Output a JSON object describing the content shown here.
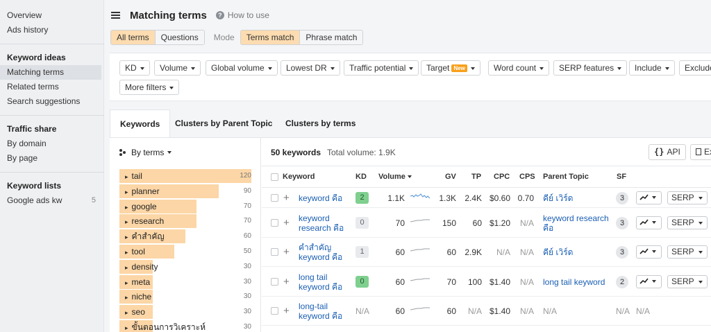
{
  "sidebar": {
    "top_items": [
      {
        "label": "Overview"
      },
      {
        "label": "Ads history"
      }
    ],
    "keyword_ideas": {
      "heading": "Keyword ideas",
      "items": [
        {
          "label": "Matching terms",
          "active": true
        },
        {
          "label": "Related terms"
        },
        {
          "label": "Search suggestions"
        }
      ]
    },
    "traffic_share": {
      "heading": "Traffic share",
      "items": [
        {
          "label": "By domain"
        },
        {
          "label": "By page"
        }
      ]
    },
    "keyword_lists": {
      "heading": "Keyword lists",
      "items": [
        {
          "label": "Google ads kw",
          "count": "5"
        }
      ]
    }
  },
  "header": {
    "title": "Matching terms",
    "how_to": "How to use",
    "help_glyph": "?"
  },
  "mode_bar": {
    "term_types": [
      "All terms",
      "Questions"
    ],
    "mode_label": "Mode",
    "match_modes": [
      "Terms match",
      "Phrase match"
    ]
  },
  "filters": {
    "buttons": [
      "KD",
      "Volume",
      "Global volume",
      "Lowest DR",
      "Traffic potential",
      "Target",
      "Word count",
      "SERP features",
      "Include",
      "Exclude"
    ],
    "new_badge": "New",
    "more": "More filters"
  },
  "tabs": [
    "Keywords",
    "Clusters by Parent Topic",
    "Clusters by terms"
  ],
  "terms_panel": {
    "sort_label": "By terms",
    "items": [
      {
        "label": "tail",
        "count": "120",
        "value": 120
      },
      {
        "label": "planner",
        "count": "90",
        "value": 90
      },
      {
        "label": "google",
        "count": "70",
        "value": 70
      },
      {
        "label": "research",
        "count": "70",
        "value": 70
      },
      {
        "label": "คำสำคัญ",
        "count": "60",
        "value": 60
      },
      {
        "label": "tool",
        "count": "50",
        "value": 50
      },
      {
        "label": "density",
        "count": "30",
        "value": 30
      },
      {
        "label": "meta",
        "count": "30",
        "value": 30
      },
      {
        "label": "niche",
        "count": "30",
        "value": 30
      },
      {
        "label": "seo",
        "count": "30",
        "value": 30
      },
      {
        "label": "ขั้นตอนการวิเคราะห์",
        "count": "30",
        "value": 30
      }
    ]
  },
  "table": {
    "count_label": "50 keywords",
    "total_volume": "Total volume: 1.9K",
    "api_label": "API",
    "api_glyph": "{}",
    "export_label": "Export",
    "columns": [
      "Keyword",
      "KD",
      "Volume",
      "GV",
      "TP",
      "CPC",
      "CPS",
      "Parent Topic",
      "SF"
    ],
    "serp_label": "SERP",
    "rows": [
      {
        "keyword": "keyword คือ",
        "kd": "2",
        "kd_color": "#7fcf8f",
        "volume": "1.1K",
        "gv": "1.3K",
        "tp": "2.4K",
        "cpc": "$0.60",
        "cps": "0.70",
        "parent": "คีย์ เวิร์ด",
        "sf": "3"
      },
      {
        "keyword": "keyword research คือ",
        "kd": "0",
        "kd_color": "#e8eaed",
        "volume": "70",
        "gv": "150",
        "tp": "60",
        "cpc": "$1.20",
        "cps": "N/A",
        "parent": "keyword research คือ",
        "sf": "3"
      },
      {
        "keyword": "คำสำคัญ keyword คือ",
        "kd": "1",
        "kd_color": "#e8eaed",
        "volume": "60",
        "gv": "60",
        "tp": "2.9K",
        "cpc": "N/A",
        "cps": "N/A",
        "parent": "คีย์ เวิร์ด",
        "sf": "3"
      },
      {
        "keyword": "long tail keyword คือ",
        "kd": "0",
        "kd_color": "#7fcf8f",
        "volume": "60",
        "gv": "70",
        "tp": "100",
        "cpc": "$1.40",
        "cps": "N/A",
        "parent": "long tail keyword",
        "sf": "2"
      },
      {
        "keyword": "long-tail keyword คือ",
        "kd": "N/A",
        "kd_color": "",
        "volume": "60",
        "gv": "60",
        "tp": "N/A",
        "cpc": "$1.40",
        "cps": "N/A",
        "parent": "N/A",
        "sf": "N/A"
      }
    ]
  },
  "colors": {
    "accent_orange": "#fcd6a6",
    "link_blue": "#1a5fb4",
    "kd_green": "#7fcf8f",
    "new_badge": "#f8a01c"
  }
}
